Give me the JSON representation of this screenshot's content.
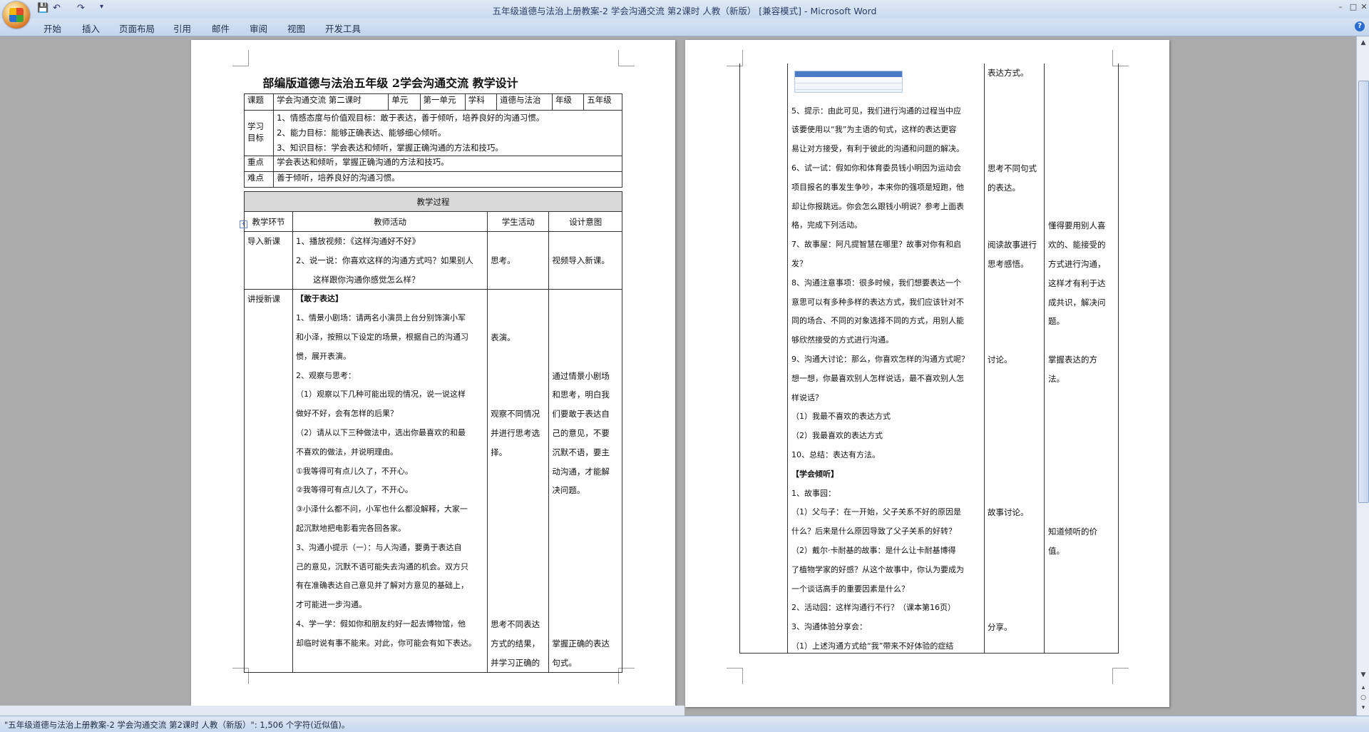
{
  "window": {
    "title": "五年级道德与法治上册教案-2 学会沟通交流  第2课时  人教（新版） [兼容模式] - Microsoft Word",
    "qat_save": "💾",
    "qat_undo": "↶",
    "qat_redo": "↷",
    "qat_more": "▾",
    "minimize": "–",
    "maximize": "□",
    "close": "✕",
    "help": "?"
  },
  "ribbon": {
    "tabs": [
      "开始",
      "插入",
      "页面布局",
      "引用",
      "邮件",
      "审阅",
      "视图",
      "开发工具"
    ]
  },
  "page1": {
    "title": "部编版道德与法治五年级  2学会沟通交流  教学设计",
    "header_row": [
      "课题",
      "学会沟通交流   第二课时",
      "单元",
      "第一单元",
      "学科",
      "道德与法治",
      "年级",
      "五年级"
    ],
    "goal_label": "学习目标",
    "goals": [
      "1、情感态度与价值观目标：敢于表达，善于倾听，培养良好的沟通习惯。",
      "2、能力目标：能够正确表达、能够细心倾听。",
      "3、知识目标：学会表达和倾听，掌握正确沟通的方法和技巧。"
    ],
    "key_label": "重点",
    "key_text": "学会表达和倾听，掌握正确沟通的方法和技巧。",
    "diff_label": "难点",
    "diff_text": "善于倾听，培养良好的沟通习惯。",
    "process_title": "教学过程",
    "process_headers": [
      "教学环节",
      "教师活动",
      "学生活动",
      "设计意图"
    ],
    "intro": {
      "stage": "导入新课",
      "teacher": [
        "1、播放视频：《这样沟通好不好》",
        "2、说一说：你喜欢这样的沟通方式吗？如果别人",
        "这样跟你沟通你感觉怎么样？"
      ],
      "student": [
        "",
        "思考。",
        ""
      ],
      "intent": [
        "",
        "视频导入新课。",
        ""
      ]
    },
    "lecture": {
      "stage": "讲授新课",
      "teacher": [
        "【敢于表达】",
        "1、情景小剧场：请两名小演员上台分别饰演小军",
        "和小泽，按照以下设定的场景，根据自己的沟通习",
        "惯，展开表演。",
        "2、观察与思考：",
        "（1）观察以下几种可能出现的情况，说一说这样",
        "做好不好，会有怎样的后果？",
        "（2）请从以下三种做法中，选出你最喜欢的和最",
        "不喜欢的做法，并说明理由。",
        "①我等得可有点儿久了，不开心。",
        "②我等得可有点儿久了，不开心。",
        "③小泽什么都不问，小军也什么都没解释，大家一",
        "起沉默地把电影看完各回各家。",
        "3、沟通小提示（一）：与人沟通，要勇于表达自",
        "己的意见，沉默不语可能失去沟通的机会。双方只",
        "有在准确表达自己意见并了解对方意见的基础上，",
        "才可能进一步沟通。",
        "4、学一学：假如你和朋友约好一起去博物馆，他",
        "却临时说有事不能来。对此，你可能会有如下表达。"
      ],
      "student": [
        "",
        "",
        "表演。",
        "",
        "",
        "",
        "观察不同情况",
        "并进行思考选",
        "择。",
        "",
        "",
        "",
        "",
        "",
        "",
        "",
        "",
        "思考不同表达",
        "方式的结果，",
        "并学习正确的"
      ],
      "intent": [
        "",
        "",
        "",
        "",
        "通过情景小剧场",
        "和思考，明白我",
        "们要敢于表达自",
        "己的意见，不要",
        "沉默不语，要主",
        "动沟通，才能解",
        "决问题。",
        "",
        "",
        "",
        "",
        "",
        "",
        "",
        "掌握正确的表达",
        "句式。"
      ]
    }
  },
  "page2": {
    "teacher": [
      "",
      "",
      "5、提示：由此可见，我们进行沟通的过程当中应",
      "该要使用以“我”为主语的句式，这样的表达更容",
      "易让对方接受，有利于彼此的沟通和问题的解决。",
      "6、试一试：假如你和体育委员钱小明因为运动会",
      "项目报名的事发生争吵，本来你的强项是短跑，他",
      "却让你报跳远。你会怎么跟钱小明说？参考上面表",
      "格，完成下列活动。",
      "7、故事屋：阿凡提智慧在哪里？故事对你有和启",
      "发？",
      "8、沟通注意事项：很多时候，我们想要表达一个",
      "意思可以有多种多样的表达方式，我们应该针对不",
      "同的场合、不同的对象选择不同的方式，用别人能",
      "够欣然接受的方式进行沟通。",
      "9、沟通大讨论：那么，你喜欢怎样的沟通方式呢？",
      "想一想，你最喜欢别人怎样说话，最不喜欢别人怎",
      "样说话？",
      "（1）我最不喜欢的表达方式",
      "（2）我最喜欢的表达方式",
      "10、总结：表达有方法。",
      "【学会倾听】",
      "1、故事园：",
      "（1）父与子：在一开始，父子关系不好的原因是",
      "什么？后来是什么原因导致了父子关系的好转？",
      "（2）戴尔·卡耐基的故事：是什么让卡耐基博得",
      "了植物学家的好感？从这个故事中，你认为要成为",
      "一个谈话高手的重要因素是什么？",
      "2、活动园：这样沟通行不行？（课本第16页）",
      "3、沟通体验分享会：",
      "（1）上述沟通方式给“我”带来不好体验的症结"
    ],
    "student": [
      "表达方式。",
      "",
      "",
      "",
      "",
      "思考不同句式",
      "的表达。",
      "",
      "",
      "阅读故事进行",
      "思考感悟。",
      "",
      "",
      "",
      "",
      "讨论。",
      "",
      "",
      "",
      "",
      "",
      "",
      "",
      "故事讨论。",
      "",
      "",
      "",
      "",
      "",
      "分享。",
      ""
    ],
    "intent": [
      "",
      "",
      "",
      "",
      "",
      "",
      "",
      "",
      "懂得要用别人喜",
      "欢的、能接受的",
      "方式进行沟通，",
      "这样才有利于达",
      "成共识，解决问",
      "题。",
      "",
      "掌握表达的方",
      "法。",
      "",
      "",
      "",
      "",
      "",
      "",
      "",
      "知道倾听的价",
      "值。",
      "",
      "",
      "",
      "",
      ""
    ]
  },
  "status": {
    "text": "\"五年级道德与法治上册教案-2 学会沟通交流  第2课时  人教（新版）\": 1,506 个字符(近似值)。"
  }
}
